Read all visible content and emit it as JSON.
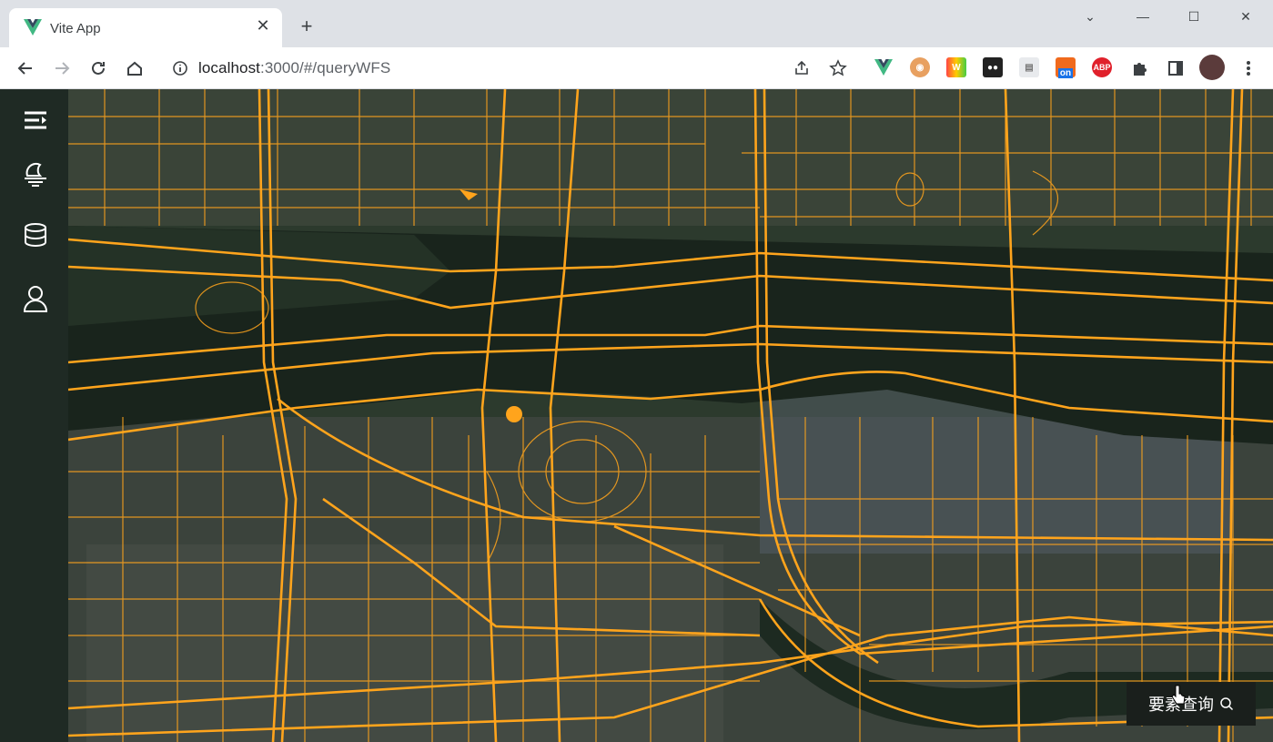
{
  "browser": {
    "tab_title": "Vite App",
    "url_host": "localhost",
    "url_rest": ":3000/#/queryWFS",
    "extensions": [
      "vue-devtools-icon",
      "owl-icon",
      "w-icon",
      "dots-icon",
      "doc-icon",
      "on-icon",
      "abp-icon",
      "puzzle-icon",
      "sidepanel-icon",
      "avatar"
    ],
    "ext_labels": {
      "on": "on",
      "abp": "ABP"
    }
  },
  "sidebar": {
    "items": [
      {
        "name": "menu-toggle",
        "icon": "menu-fold-icon"
      },
      {
        "name": "layers",
        "icon": "sunset-icon"
      },
      {
        "name": "database",
        "icon": "database-icon"
      },
      {
        "name": "user",
        "icon": "user-icon"
      }
    ]
  },
  "map": {
    "road_color": "#ffa41c",
    "water_color": "#1c2a22"
  },
  "query_button": {
    "label": "要素查询"
  }
}
